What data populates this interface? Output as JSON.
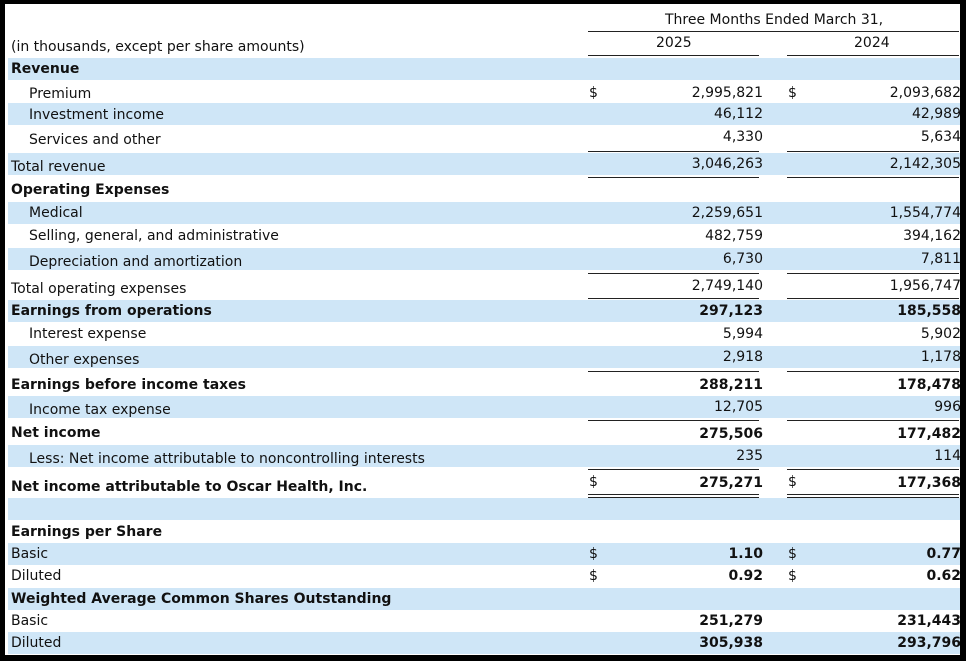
{
  "header": {
    "unit_note": "(in thousands, except per share amounts)",
    "period": "Three Months Ended March 31,",
    "col_2025": "2025",
    "col_2024": "2024"
  },
  "currency": "$",
  "rows": [
    {
      "label": "Revenue"
    },
    {
      "label": "Premium",
      "v2025": "2,995,821",
      "v2024": "2,093,682"
    },
    {
      "label": "Investment income",
      "v2025": "46,112",
      "v2024": "42,989"
    },
    {
      "label": "Services and other",
      "v2025": "4,330",
      "v2024": "5,634"
    },
    {
      "label": "Total revenue",
      "v2025": "3,046,263",
      "v2024": "2,142,305"
    },
    {
      "label": "Operating Expenses"
    },
    {
      "label": "Medical",
      "v2025": "2,259,651",
      "v2024": "1,554,774"
    },
    {
      "label": "Selling, general, and administrative",
      "v2025": "482,759",
      "v2024": "394,162"
    },
    {
      "label": "Depreciation and amortization",
      "v2025": "6,730",
      "v2024": "7,811"
    },
    {
      "label": "Total operating expenses",
      "v2025": "2,749,140",
      "v2024": "1,956,747"
    },
    {
      "label": "Earnings from operations",
      "v2025": "297,123",
      "v2024": "185,558"
    },
    {
      "label": "Interest expense",
      "v2025": "5,994",
      "v2024": "5,902"
    },
    {
      "label": "Other expenses",
      "v2025": "2,918",
      "v2024": "1,178"
    },
    {
      "label": "Earnings before income taxes",
      "v2025": "288,211",
      "v2024": "178,478"
    },
    {
      "label": "Income tax expense",
      "v2025": "12,705",
      "v2024": "996"
    },
    {
      "label": "Net income",
      "v2025": "275,506",
      "v2024": "177,482"
    },
    {
      "label": "Less: Net income attributable to noncontrolling interests",
      "v2025": "235",
      "v2024": "114"
    },
    {
      "label": "Net income attributable to Oscar Health, Inc.",
      "v2025": "275,271",
      "v2024": "177,368"
    },
    {
      "label": ""
    },
    {
      "label": "Earnings per Share"
    },
    {
      "label": "Basic",
      "v2025": "1.10",
      "v2024": "0.77"
    },
    {
      "label": "Diluted",
      "v2025": "0.92",
      "v2024": "0.62"
    },
    {
      "label": "Weighted Average Common Shares Outstanding"
    },
    {
      "label": "Basic",
      "v2025": "251,279",
      "v2024": "231,443"
    },
    {
      "label": "Diluted",
      "v2025": "305,938",
      "v2024": "293,796"
    }
  ]
}
